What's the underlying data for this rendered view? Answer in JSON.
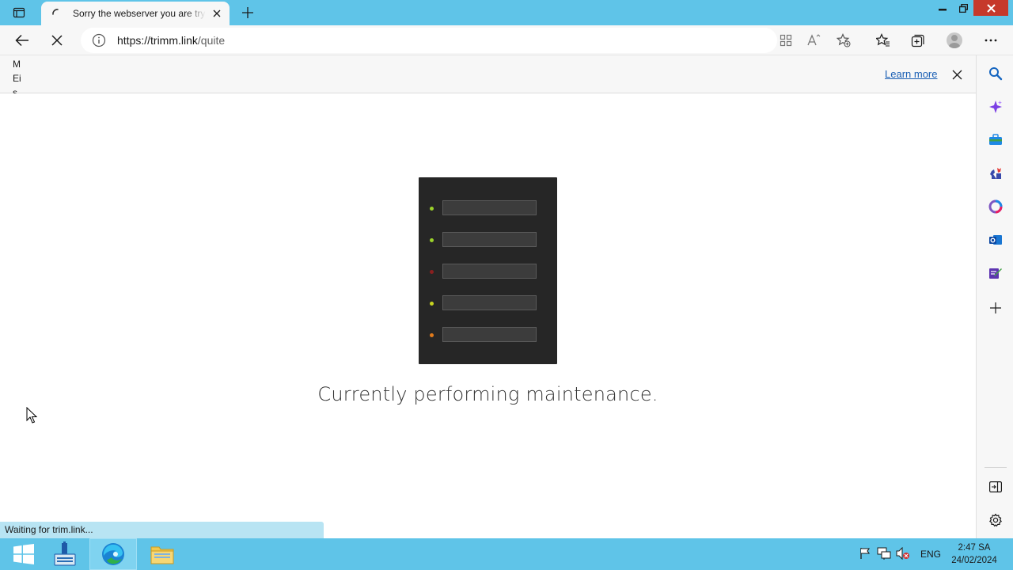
{
  "browser": {
    "tab_title": "Sorry the webserver you are trying",
    "address": {
      "url_host": "https://trimm.link",
      "url_path": "/quite"
    },
    "infobar": {
      "message": "MEis",
      "learn_more": "Learn more"
    },
    "status_text": "Waiting for trim.link..."
  },
  "page": {
    "heading": "Currently performing maintenance.",
    "server_leds": [
      "#9bd22a",
      "#9bd22a",
      "#8a1f1f",
      "#c8d420",
      "#e07a1b"
    ]
  },
  "sidebar": {
    "items": [
      "search-icon",
      "copilot-icon",
      "shopping-icon",
      "games-icon",
      "microsoft365-icon",
      "outlook-icon",
      "drop-icon",
      "add-icon"
    ],
    "bottom": [
      "hide-sidebar-icon",
      "settings-icon"
    ]
  },
  "taskbar": {
    "apps": [
      "start-button",
      "server-manager",
      "edge",
      "file-explorer"
    ],
    "language": "ENG",
    "time": "2:47 SA",
    "date": "24/02/2024"
  },
  "colors": {
    "accent": "#5fc4e8",
    "status_bg": "#b8e4f3",
    "link": "#1a5fb4"
  }
}
